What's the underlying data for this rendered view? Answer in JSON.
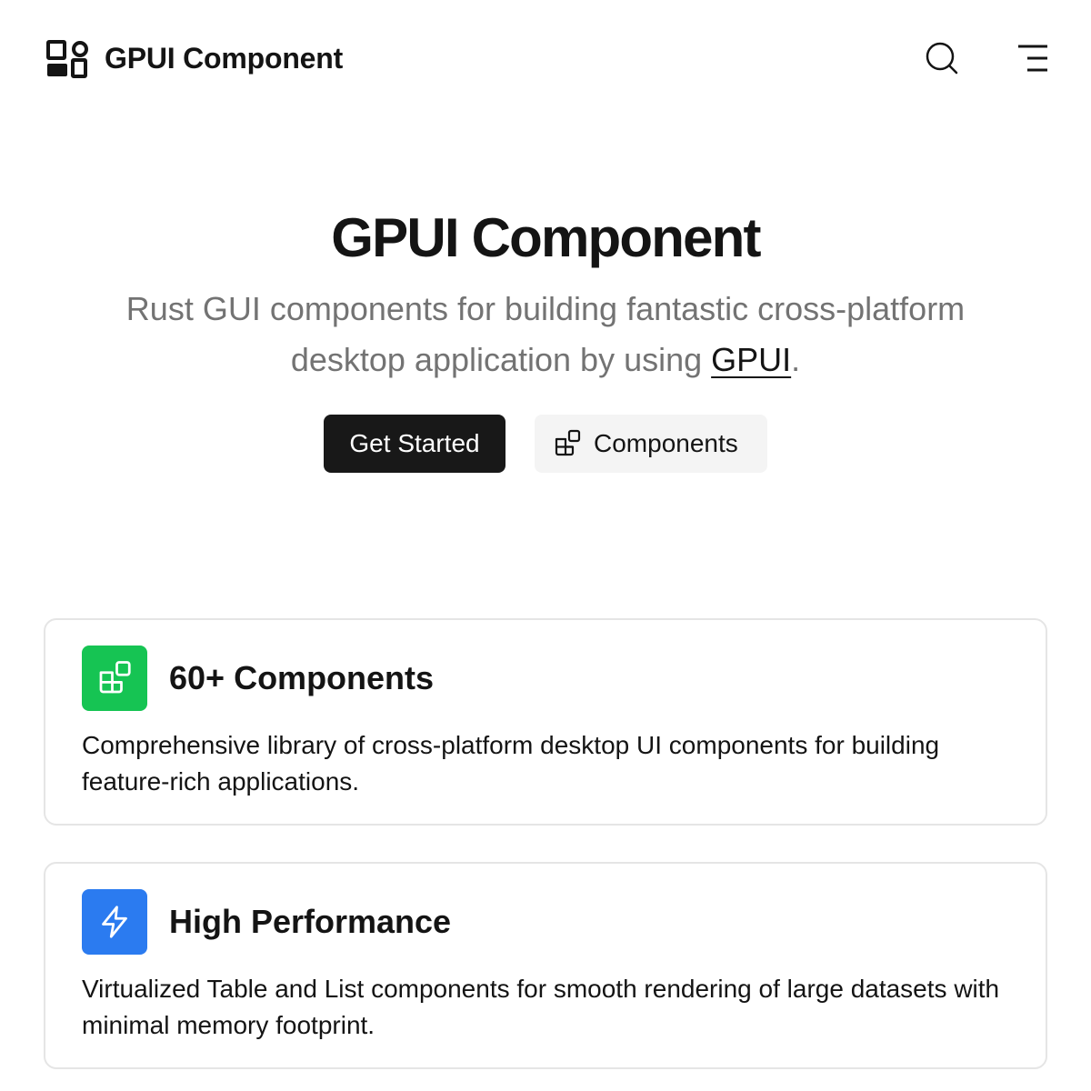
{
  "header": {
    "logo_icon": "layout-grid-icon",
    "title": "GPUI Component",
    "search_icon": "search-icon",
    "menu_icon": "menu-icon"
  },
  "hero": {
    "title": "GPUI Component",
    "subtitle_prefix": "Rust GUI components for building fantastic cross-platform desktop application by using ",
    "subtitle_link": "GPUI",
    "subtitle_suffix": ".",
    "primary_button": "Get Started",
    "secondary_button": "Components",
    "secondary_button_icon": "components-icon"
  },
  "features": [
    {
      "title": "60+ Components",
      "description": "Comprehensive library of cross-platform desktop UI components for building feature-rich applications.",
      "icon": "components-icon",
      "icon_bg": "#16c453"
    },
    {
      "title": "High Performance",
      "description": "Virtualized Table and List components for smooth rendering of large datasets with minimal memory footprint.",
      "icon": "zap-icon",
      "icon_bg": "#2b7bf0"
    }
  ],
  "colors": {
    "primary_button_bg": "#181818",
    "secondary_button_bg": "#f4f4f4",
    "subtitle_text": "#737373",
    "card_border": "#e5e5e5"
  }
}
